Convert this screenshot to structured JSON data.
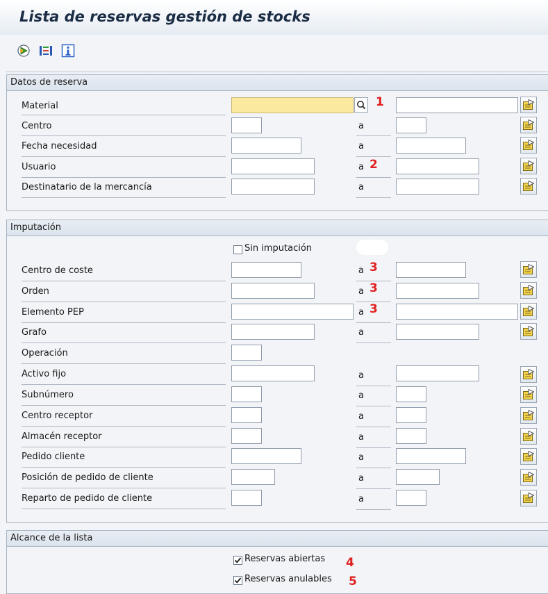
{
  "window": {
    "title": "Lista de reservas gestión de stocks"
  },
  "toolbar": {
    "buttons": [
      {
        "icon": "execute-icon"
      },
      {
        "icon": "selection-options-icon"
      },
      {
        "icon": "info-icon"
      }
    ]
  },
  "sections": {
    "datos_reserva": {
      "title": "Datos de reserva",
      "fields": {
        "material": "Material",
        "centro": "Centro",
        "fecha_necesidad": "Fecha necesidad",
        "usuario": "Usuario",
        "destinatario": "Destinatario de la mercancía"
      }
    },
    "imputacion": {
      "title": "Imputación",
      "sin_imputacion": "Sin imputación",
      "fields": {
        "centro_coste": "Centro de coste",
        "orden": "Orden",
        "elemento_pep": "Elemento PEP",
        "grafo": "Grafo",
        "operacion": "Operación",
        "activo_fijo": "Activo fijo",
        "subnumero": "Subnúmero",
        "centro_receptor": "Centro receptor",
        "almacen_receptor": "Almacén receptor",
        "pedido_cliente": "Pedido cliente",
        "posicion_pedido": "Posición de pedido de cliente",
        "reparto_pedido": "Reparto de pedido de cliente"
      }
    },
    "alcance": {
      "title": "Alcance de la lista",
      "reservas_abiertas": "Reservas abiertas",
      "reservas_abiertas_checked": true,
      "reservas_anulables": "Reservas anulables",
      "reservas_anulables_checked": true
    }
  },
  "range_label": "a",
  "annotations": [
    "1",
    "2",
    "3",
    "3",
    "3",
    "4",
    "5"
  ],
  "colors": {
    "annotation": "#e02020",
    "required_field": "#fbe99f",
    "title_text": "#1b2d45"
  }
}
